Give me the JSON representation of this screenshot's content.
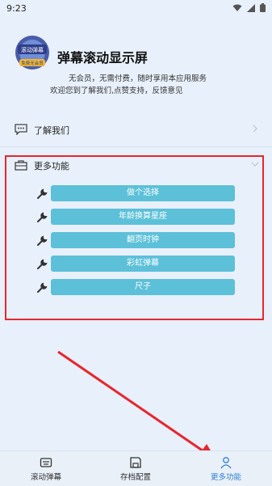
{
  "status_bar": {
    "time": "9:23"
  },
  "header": {
    "logo_text_top": "滚动弹幕",
    "logo_text_bottom": "免费无会员",
    "title": "弹幕滚动显示屏",
    "line1": "无会员，无需付费，随时享用本应用服务",
    "line2": "欢迎您到了解我们,点赞支持，反馈意见"
  },
  "menu": {
    "about_label": "了解我们",
    "more_label": "更多功能"
  },
  "features": [
    {
      "label": "做个选择"
    },
    {
      "label": "年龄换算星座"
    },
    {
      "label": "翻页时钟"
    },
    {
      "label": "彩虹弹幕"
    },
    {
      "label": "尺子"
    }
  ],
  "tabs": [
    {
      "label": "滚动弹幕",
      "active": false
    },
    {
      "label": "存档配置",
      "active": false
    },
    {
      "label": "更多功能",
      "active": true
    }
  ],
  "colors": {
    "background": "#e8f1fb",
    "feature_button": "#5bc0d8",
    "highlight": "#e8262d",
    "active_tab": "#2f80d8"
  }
}
